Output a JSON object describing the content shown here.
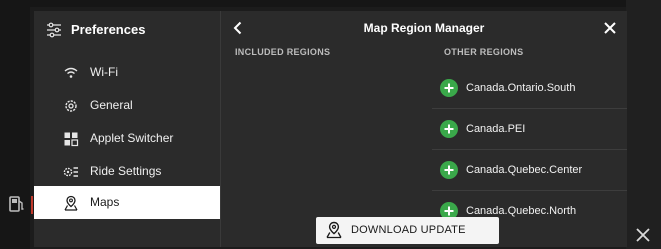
{
  "background": {
    "close_icon": "close-icon",
    "fuel_icon": "fuel-pump-icon"
  },
  "preferences": {
    "title": "Preferences",
    "icon": "sliders-icon",
    "items": [
      {
        "label": "Wi-Fi",
        "icon": "wifi-icon",
        "active": false
      },
      {
        "label": "General",
        "icon": "gear-icon",
        "active": false
      },
      {
        "label": "Applet Switcher",
        "icon": "grid-icon",
        "active": false
      },
      {
        "label": "Ride Settings",
        "icon": "ride-settings-icon",
        "active": false
      },
      {
        "label": "Maps",
        "icon": "map-pin-icon",
        "active": true
      }
    ]
  },
  "region_manager": {
    "title": "Map Region Manager",
    "back_icon": "chevron-left-icon",
    "close_icon": "close-icon",
    "included_header": "INCLUDED REGIONS",
    "other_header": "OTHER REGIONS",
    "other_regions": [
      {
        "label": "Canada.Ontario.South",
        "icon": "add-icon"
      },
      {
        "label": "Canada.PEI",
        "icon": "add-icon"
      },
      {
        "label": "Canada.Quebec.Center",
        "icon": "add-icon"
      },
      {
        "label": "Canada.Quebec.North",
        "icon": "add-icon"
      }
    ],
    "download_button": {
      "label": "DOWNLOAD UPDATE",
      "icon": "map-pin-icon"
    }
  },
  "colors": {
    "dialog_bg": "#2b2b2b",
    "active_item_bg": "#ffffff",
    "add_green": "#3aa84a",
    "button_bg": "#f4f4f4"
  }
}
